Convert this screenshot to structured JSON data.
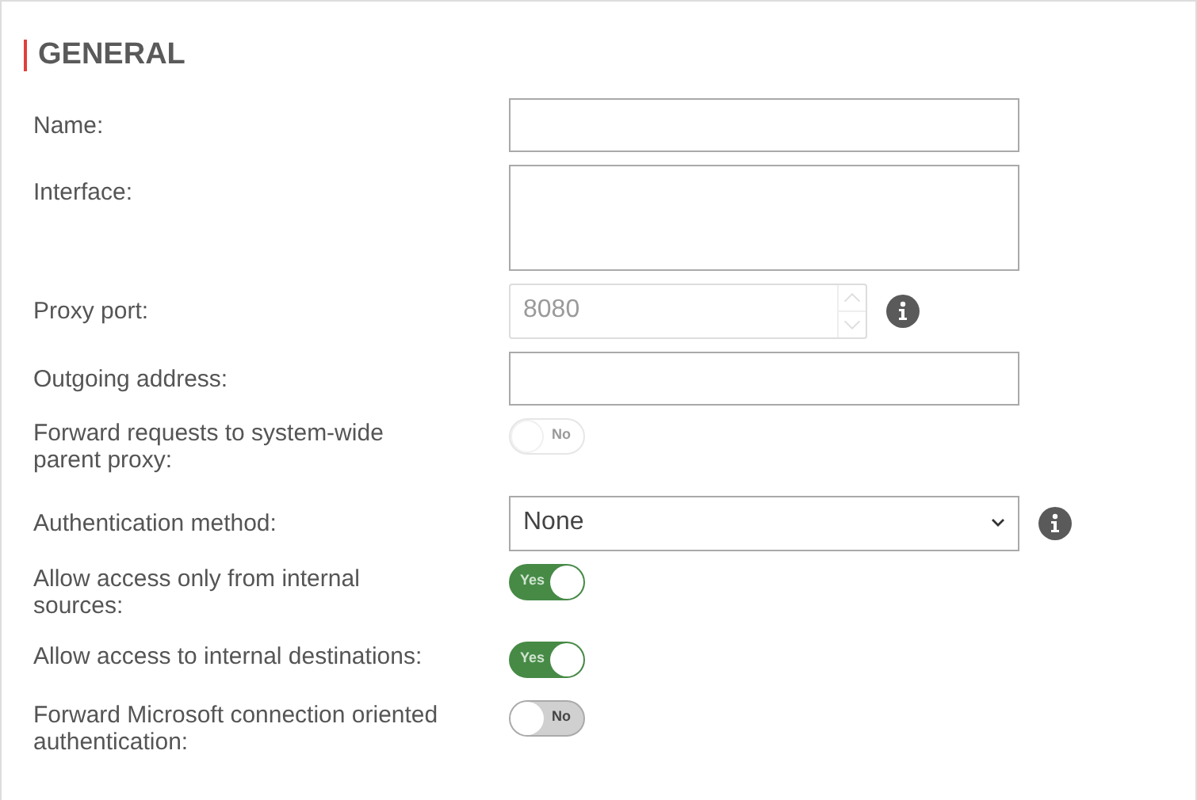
{
  "section": {
    "title": "GENERAL"
  },
  "fields": [
    {
      "kind": "text",
      "label": "Name:"
    },
    {
      "kind": "textarea",
      "label": "Interface:"
    },
    {
      "kind": "number",
      "label": "Proxy port:",
      "value": "8080",
      "disabled": true,
      "info": true
    },
    {
      "kind": "text",
      "label": "Outgoing address:"
    },
    {
      "kind": "toggle",
      "label": "Forward requests to system-wide parent proxy:",
      "on": false,
      "disabled": true,
      "text": "No"
    },
    {
      "kind": "select",
      "label": "Authentication method:",
      "value": "None",
      "info": true
    },
    {
      "kind": "toggle",
      "label": "Allow access only from internal sources:",
      "on": true,
      "disabled": false,
      "text": "Yes"
    },
    {
      "kind": "toggle",
      "label": "Allow access to internal destinations:",
      "on": true,
      "disabled": false,
      "text": "Yes"
    },
    {
      "kind": "toggle",
      "label": "Forward Microsoft connection oriented authentication:",
      "on": false,
      "disabled": false,
      "text": "No"
    }
  ]
}
